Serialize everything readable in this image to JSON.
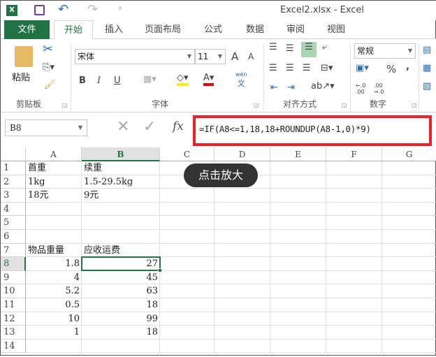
{
  "title": "Excel2.xlsx - Excel",
  "tabs": [
    "文件",
    "开始",
    "插入",
    "页面布局",
    "公式",
    "数据",
    "审阅",
    "视图"
  ],
  "ribbon": {
    "paste": "粘贴",
    "clipboard": "剪贴板",
    "font_name": "宋体",
    "font_size": "11",
    "bold": "B",
    "italic": "I",
    "underline": "U",
    "grow": "A",
    "shrink": "A",
    "phonetic": "wén",
    "phonetic2": "文",
    "font_group": "字体",
    "align_group": "对齐方式",
    "number_format": "常规",
    "percent": "%",
    "comma": ",",
    "inc_dec": "←.0 .00",
    "dec_dec": ".00 →.0",
    "number_group": "数字"
  },
  "formula_bar": {
    "name_box": "B8",
    "fx": "fx",
    "formula": "=IF(A8<=1,18,18+ROUNDUP(A8-1,0)*9)"
  },
  "tooltip": "点击放大",
  "columns": [
    "A",
    "B",
    "C",
    "D",
    "E",
    "F",
    "G"
  ],
  "rows": [
    {
      "n": "1",
      "a": "首重",
      "b": "续重"
    },
    {
      "n": "2",
      "a": "1kg",
      "b": "1.5-29.5kg"
    },
    {
      "n": "3",
      "a": "18元",
      "b": "9元"
    },
    {
      "n": "4",
      "a": "",
      "b": ""
    },
    {
      "n": "5",
      "a": "",
      "b": ""
    },
    {
      "n": "6",
      "a": "",
      "b": ""
    },
    {
      "n": "7",
      "a": "物品重量",
      "b": "应收运费"
    },
    {
      "n": "8",
      "a": "1.8",
      "b": "27"
    },
    {
      "n": "9",
      "a": "4",
      "b": "45"
    },
    {
      "n": "10",
      "a": "5.2",
      "b": "63"
    },
    {
      "n": "11",
      "a": "0.5",
      "b": "18"
    },
    {
      "n": "12",
      "a": "10",
      "b": "99"
    },
    {
      "n": "13",
      "a": "1",
      "b": "18"
    },
    {
      "n": "14",
      "a": "",
      "b": ""
    }
  ],
  "colors": {
    "accent": "#217346",
    "highlight": "#e8232b"
  }
}
